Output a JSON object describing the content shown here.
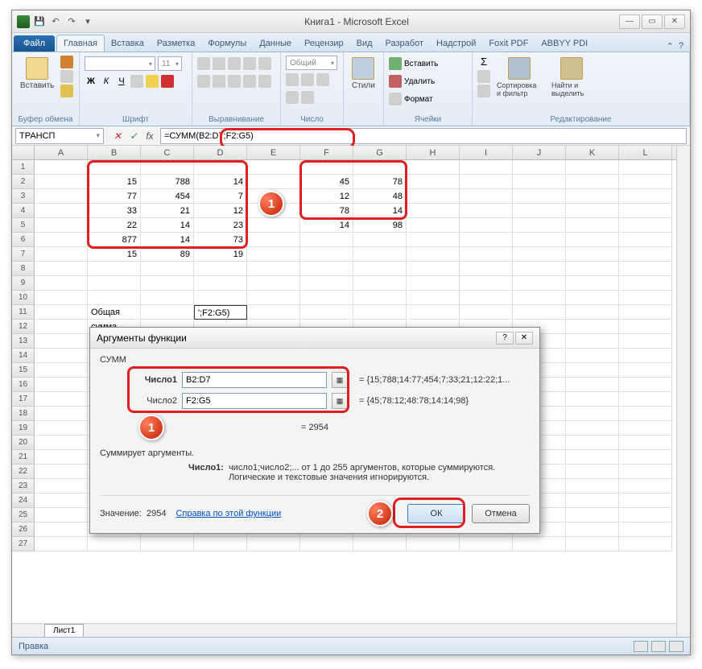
{
  "window": {
    "title": "Книга1 - Microsoft Excel"
  },
  "ribbon_tabs": {
    "file": "Файл",
    "items": [
      "Главная",
      "Вставка",
      "Разметка",
      "Формулы",
      "Данные",
      "Рецензир",
      "Вид",
      "Разработ",
      "Надстрой",
      "Foxit PDF",
      "ABBYY PDI"
    ],
    "active": 0
  },
  "ribbon": {
    "clipboard": {
      "paste": "Вставить",
      "label": "Буфер обмена"
    },
    "font": {
      "label": "Шрифт",
      "name": "",
      "size": "11"
    },
    "align": {
      "label": "Выравнивание"
    },
    "number": {
      "format": "Общий",
      "label": "Число"
    },
    "styles": {
      "btn": "Стили"
    },
    "cells": {
      "insert": "Вставить",
      "delete": "Удалить",
      "format": "Формат",
      "label": "Ячейки"
    },
    "editing": {
      "sort": "Сортировка и фильтр",
      "find": "Найти и выделить",
      "label": "Редактирование"
    }
  },
  "formula_bar": {
    "namebox": "ТРАНСП",
    "formula": "=СУММ(B2:D7;F2:G5)"
  },
  "columns": [
    "A",
    "B",
    "C",
    "D",
    "E",
    "F",
    "G",
    "H",
    "I",
    "J",
    "K",
    "L"
  ],
  "grid": {
    "rows": 27,
    "data1": [
      [
        "15",
        "788",
        "14"
      ],
      [
        "77",
        "454",
        "7"
      ],
      [
        "33",
        "21",
        "12"
      ],
      [
        "22",
        "14",
        "23"
      ],
      [
        "877",
        "14",
        "73"
      ],
      [
        "15",
        "89",
        "19"
      ]
    ],
    "data2": [
      [
        "45",
        "78"
      ],
      [
        "12",
        "48"
      ],
      [
        "78",
        "14"
      ],
      [
        "14",
        "98"
      ]
    ],
    "sum_label": "Общая сумма",
    "sum_cell": "';F2:G5)"
  },
  "dialog": {
    "title": "Аргументы функции",
    "fn": "СУММ",
    "arg1_label": "Число1",
    "arg1_value": "B2:D7",
    "arg1_preview": "= {15;788;14:77;454;7:33;21;12:22;1...",
    "arg2_label": "Число2",
    "arg2_value": "F2:G5",
    "arg2_preview": "= {45;78:12;48:78;14:14;98}",
    "desc": "Суммирует аргументы.",
    "result_eq": "= 2954",
    "argdesc_name": "Число1:",
    "argdesc_text": "число1;число2;... от 1 до 255 аргументов, которые суммируются. Логические и текстовые значения игнорируются.",
    "value_label": "Значение:",
    "value": "2954",
    "help": "Справка по этой функции",
    "ok": "ОК",
    "cancel": "Отмена"
  },
  "status": {
    "mode": "Правка",
    "sheet": "Лист1"
  },
  "badges": {
    "one": "1",
    "two": "2"
  }
}
